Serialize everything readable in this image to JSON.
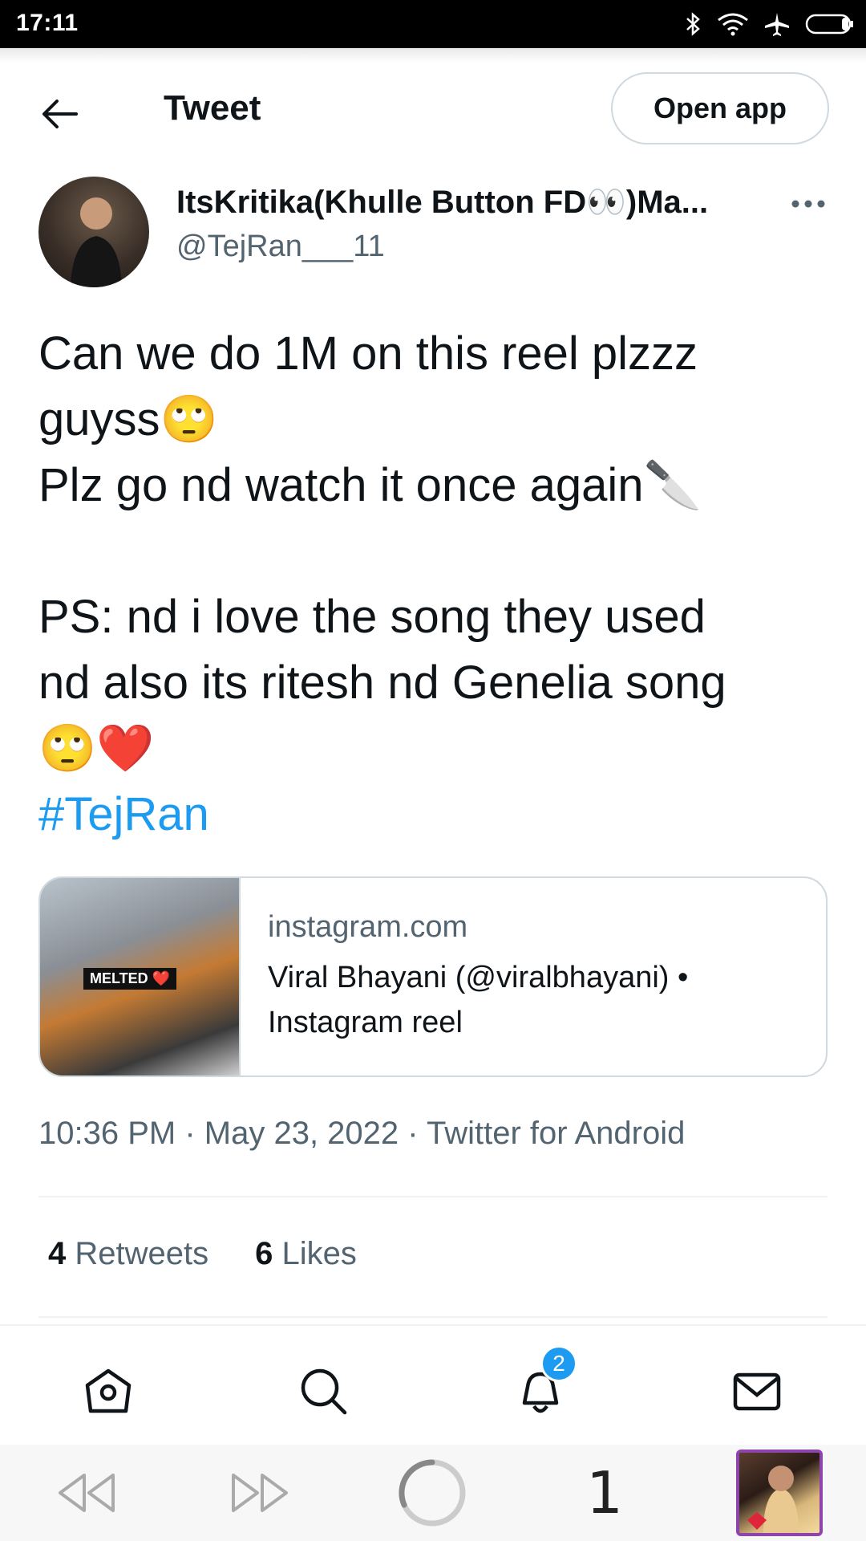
{
  "status_bar": {
    "time": "17:11"
  },
  "header": {
    "title": "Tweet",
    "open_app_label": "Open app"
  },
  "author": {
    "name": "ItsKritika(Khulle Button FD👀)Ma...",
    "handle": "@TejRan___11"
  },
  "tweet": {
    "lines": [
      "Can we do 1M on this reel plzzz",
      "guyss🙄",
      "Plz go nd watch it once again🔪",
      "",
      "PS: nd i love the song they used",
      "nd also its ritesh nd Genelia song",
      "🙄❤️"
    ],
    "hashtag": "#TejRan"
  },
  "link_card": {
    "domain": "instagram.com",
    "title": "Viral Bhayani (@viralbhayani) • Instagram reel",
    "thumbnail_tag": "MELTED ❤️"
  },
  "meta": {
    "time": "10:36 PM",
    "date": "May 23, 2022",
    "source": "Twitter for Android",
    "separator": " · "
  },
  "stats": {
    "retweets_count": "4",
    "retweets_label": "Retweets",
    "likes_count": "6",
    "likes_label": "Likes"
  },
  "bottom_nav": {
    "items": [
      "home-icon",
      "search-icon",
      "notifications-icon",
      "messages-icon"
    ],
    "notification_badge": "2"
  },
  "browser_bar": {
    "tab_count": "1"
  },
  "colors": {
    "accent": "#1d9bf0",
    "text": "#0f1419",
    "secondary": "#536471",
    "border": "#cfd9de"
  }
}
